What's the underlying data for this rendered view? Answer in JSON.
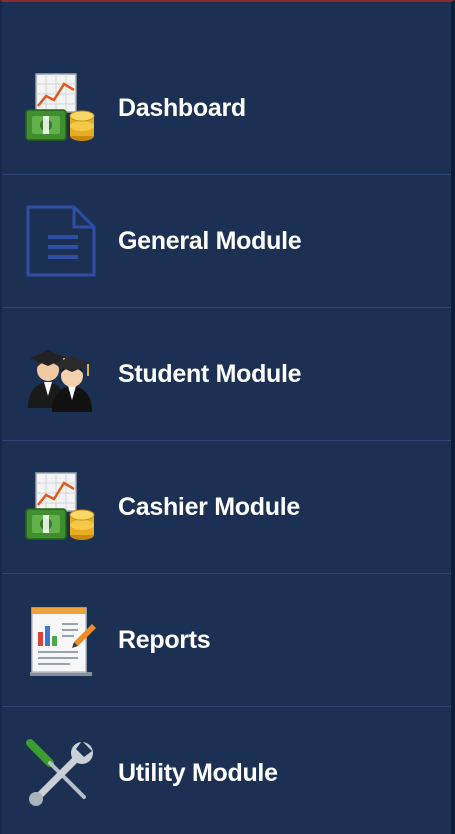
{
  "menu": {
    "items": [
      {
        "label": "Dashboard",
        "icon": "chart-money-icon"
      },
      {
        "label": "General Module",
        "icon": "document-icon"
      },
      {
        "label": "Student Module",
        "icon": "graduates-icon"
      },
      {
        "label": "Cashier Module",
        "icon": "chart-money-icon"
      },
      {
        "label": "Reports",
        "icon": "report-icon"
      },
      {
        "label": "Utility Module",
        "icon": "tools-icon"
      }
    ]
  },
  "colors": {
    "background": "#1c3054",
    "divider": "#2b4470",
    "label": "#ffffff"
  }
}
